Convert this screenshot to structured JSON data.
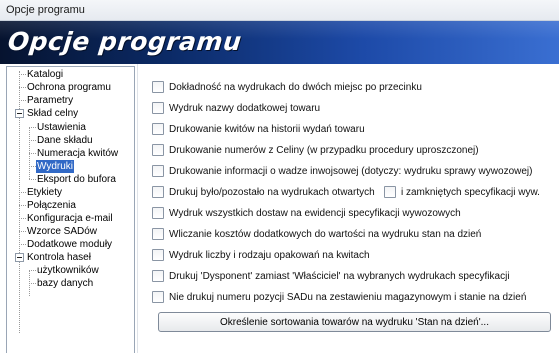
{
  "window": {
    "title": "Opcje programu"
  },
  "banner": {
    "title": "Opcje programu"
  },
  "tree": [
    {
      "label": "Katalogi"
    },
    {
      "label": "Ochrona programu"
    },
    {
      "label": "Parametry"
    },
    {
      "label": "Skład celny",
      "expanded": true
    },
    {
      "label": "Ustawienia"
    },
    {
      "label": "Dane składu"
    },
    {
      "label": "Numeracja kwitów"
    },
    {
      "label": "Wydruki",
      "selected": true
    },
    {
      "label": "Eksport do bufora"
    },
    {
      "label": "Etykiety"
    },
    {
      "label": "Połączenia"
    },
    {
      "label": "Konfiguracja e-mail"
    },
    {
      "label": "Wzorce SADów"
    },
    {
      "label": "Dodatkowe moduły"
    },
    {
      "label": "Kontrola haseł",
      "expanded": true
    },
    {
      "label": "użytkowników"
    },
    {
      "label": "bazy danych"
    }
  ],
  "options": [
    {
      "label": "Dokładność na wydrukach do dwóch miejsc po przecinku",
      "checked": false
    },
    {
      "label": "Wydruk nazwy dodatkowej towaru",
      "checked": false
    },
    {
      "label": "Drukowanie kwitów na historii wydań towaru",
      "checked": false
    },
    {
      "label": "Drukowanie numerów z Celiny (w przypadku procedury uproszczonej)",
      "checked": false
    },
    {
      "label": "Drukowanie informacji o wadze inwojsowej (dotyczy: wydruku sprawy wywozowej)",
      "checked": false
    },
    {
      "label": "Drukuj było/pozostało na wydrukach otwartych",
      "checked": false
    },
    {
      "label": "i zamkniętych specyfikacji wyw.",
      "checked": false
    },
    {
      "label": "Wydruk wszystkich dostaw na ewidencji specyfikacji wywozowych",
      "checked": false
    },
    {
      "label": "Wliczanie kosztów dodatkowych do wartości na wydruku stan na dzień",
      "checked": false
    },
    {
      "label": "Wydruk liczby i rodzaju opakowań na kwitach",
      "checked": false
    },
    {
      "label": "Drukuj 'Dysponent' zamiast 'Właściciel' na wybranych wydrukach specyfikacji",
      "checked": false
    },
    {
      "label": "Nie drukuj numeru pozycji SADu na zestawieniu magazynowym i stanie na dzień",
      "checked": false
    }
  ],
  "buttons": {
    "sort_order": "Określenie sortowania towarów na wydruku 'Stan na dzień'..."
  },
  "colors": {
    "selection": "#3169c6",
    "banner_dark": "#06132f",
    "banner_light": "#3a6fd2"
  }
}
